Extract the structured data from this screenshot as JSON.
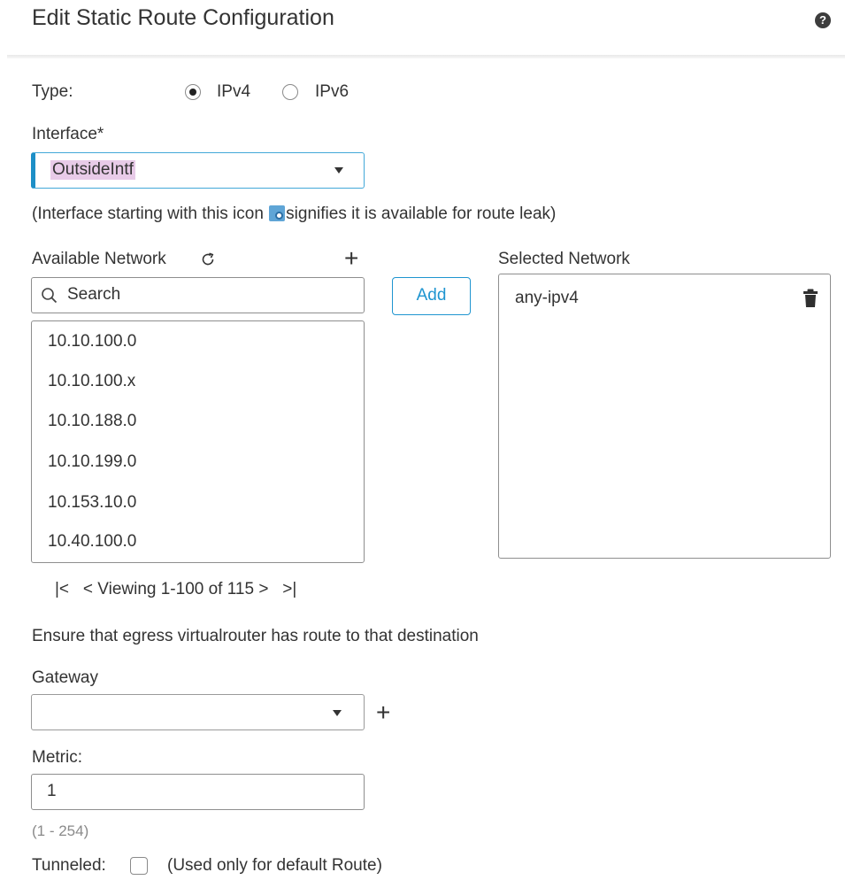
{
  "header": {
    "title": "Edit Static Route Configuration",
    "help_icon": "?"
  },
  "type_field": {
    "label": "Type:",
    "options": [
      "IPv4",
      "IPv6"
    ],
    "selected": "IPv4"
  },
  "interface": {
    "label": "Interface*",
    "value": "OutsideIntf",
    "note_before": "(Interface starting with this icon ",
    "note_after": "signifies it is available for route leak)"
  },
  "available": {
    "label": "Available Network",
    "search_placeholder": "Search",
    "items": [
      "10.10.100.0",
      "10.10.100.x",
      "10.10.188.0",
      "10.10.199.0",
      "10.153.10.0",
      "10.40.100.0"
    ],
    "pager": {
      "first": "|<",
      "prev": "<",
      "text": "Viewing 1-100 of 115",
      "next": ">",
      "last": ">|"
    }
  },
  "add_button": "Add",
  "selected": {
    "label": "Selected Network",
    "items": [
      "any-ipv4"
    ]
  },
  "egress_note": "Ensure that egress virtualrouter has route to that destination",
  "gateway": {
    "label": "Gateway",
    "value": ""
  },
  "metric": {
    "label": "Metric:",
    "value": "1",
    "hint": "(1 - 254)"
  },
  "tunneled": {
    "label": "Tunneled:",
    "checked": false,
    "note": "(Used only for default Route)"
  },
  "colors": {
    "accent": "#1f95d0",
    "highlight": "#e8cbe8",
    "text": "#333333"
  }
}
